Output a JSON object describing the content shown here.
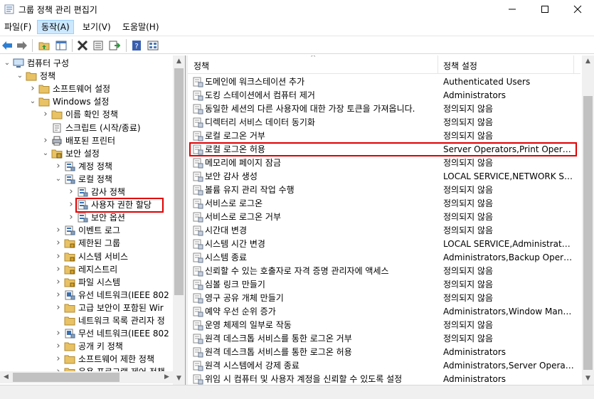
{
  "window": {
    "title": "그룹 정책 관리 편집기"
  },
  "menu": [
    {
      "label": "파일(F)"
    },
    {
      "label": "동작(A)",
      "active": true
    },
    {
      "label": "보기(V)"
    },
    {
      "label": "도움말(H)"
    }
  ],
  "toolbar": {
    "buttons": [
      "back-icon",
      "forward-icon",
      "up-folder-icon",
      "show-hide-tree-icon",
      "delete-icon",
      "properties-icon",
      "export-list-icon",
      "help-icon",
      "view-icon"
    ]
  },
  "tree": {
    "items": [
      {
        "label": "컴퓨터 구성",
        "level": 0,
        "expanded": true,
        "icon": "computer-icon"
      },
      {
        "label": "정책",
        "level": 1,
        "expanded": true,
        "icon": "folder-icon"
      },
      {
        "label": "소프트웨어 설정",
        "level": 2,
        "expanded": false,
        "icon": "folder-icon"
      },
      {
        "label": "Windows 설정",
        "level": 2,
        "expanded": true,
        "icon": "folder-icon"
      },
      {
        "label": "이름 확인 정책",
        "level": 3,
        "expanded": false,
        "icon": "folder-icon"
      },
      {
        "label": "스크립트 (시작/종료)",
        "level": 3,
        "leaf": true,
        "icon": "script-icon"
      },
      {
        "label": "배포된 프린터",
        "level": 3,
        "expanded": false,
        "icon": "printer-icon"
      },
      {
        "label": "보안 설정",
        "level": 3,
        "expanded": true,
        "icon": "security-icon"
      },
      {
        "label": "계정 정책",
        "level": 4,
        "expanded": false,
        "icon": "policy-icon"
      },
      {
        "label": "로컬 정책",
        "level": 4,
        "expanded": true,
        "icon": "policy-icon"
      },
      {
        "label": "감사 정책",
        "level": 5,
        "expanded": false,
        "icon": "policy-icon"
      },
      {
        "label": "사용자 권한 할당",
        "level": 5,
        "expanded": false,
        "icon": "policy-icon",
        "selected": true
      },
      {
        "label": "보안 옵션",
        "level": 5,
        "expanded": false,
        "icon": "policy-icon"
      },
      {
        "label": "이벤트 로그",
        "level": 4,
        "expanded": false,
        "icon": "policy-icon"
      },
      {
        "label": "제한된 그룹",
        "level": 4,
        "expanded": false,
        "icon": "lock-folder-icon"
      },
      {
        "label": "시스템 서비스",
        "level": 4,
        "expanded": false,
        "icon": "lock-folder-icon"
      },
      {
        "label": "레지스트리",
        "level": 4,
        "expanded": false,
        "icon": "lock-folder-icon"
      },
      {
        "label": "파일 시스템",
        "level": 4,
        "expanded": false,
        "icon": "lock-folder-icon"
      },
      {
        "label": "유선 네트워크(IEEE 802",
        "level": 4,
        "expanded": false,
        "icon": "network-icon"
      },
      {
        "label": "고급 보안이 포함된 Wir",
        "level": 4,
        "expanded": false,
        "icon": "folder-icon"
      },
      {
        "label": "네트워크 목록 관리자 정",
        "level": 4,
        "leaf": true,
        "icon": "folder-icon"
      },
      {
        "label": "무선 네트워크(IEEE 802",
        "level": 4,
        "expanded": false,
        "icon": "network-icon"
      },
      {
        "label": "공개 키 정책",
        "level": 4,
        "expanded": false,
        "icon": "folder-icon"
      },
      {
        "label": "소프트웨어 제한 정책",
        "level": 4,
        "expanded": false,
        "icon": "folder-icon"
      },
      {
        "label": "응용 프로그램 제어 정책",
        "level": 4,
        "expanded": false,
        "icon": "folder-icon"
      }
    ]
  },
  "list": {
    "columns": [
      "정책",
      "정책 설정"
    ],
    "rows": [
      {
        "name": "도메인에 워크스테이션 추가",
        "value": "Authenticated Users"
      },
      {
        "name": "도킹 스테이션에서 컴퓨터 제거",
        "value": "Administrators"
      },
      {
        "name": "동일한 세션의 다른 사용자에 대한 가장 토큰을 가져옵니다.",
        "value": "정의되지 않음"
      },
      {
        "name": "디렉터리 서비스 데이터 동기화",
        "value": "정의되지 않음"
      },
      {
        "name": "로컬 로그온 거부",
        "value": "정의되지 않음"
      },
      {
        "name": "로컬 로그온 허용",
        "value": "Server Operators,Print Operator...",
        "highlight": true
      },
      {
        "name": "메모리에 페이지 잠금",
        "value": "정의되지 않음"
      },
      {
        "name": "보안 감사 생성",
        "value": "LOCAL SERVICE,NETWORK SER..."
      },
      {
        "name": "볼륨 유지 관리 작업 수행",
        "value": "정의되지 않음"
      },
      {
        "name": "서비스로 로그온",
        "value": "정의되지 않음"
      },
      {
        "name": "서비스로 로그온 거부",
        "value": "정의되지 않음"
      },
      {
        "name": "시간대 변경",
        "value": "정의되지 않음"
      },
      {
        "name": "시스템 시간 변경",
        "value": "LOCAL SERVICE,Administrators..."
      },
      {
        "name": "시스템 종료",
        "value": "Administrators,Backup Operato..."
      },
      {
        "name": "신뢰할 수 있는 호출자로 자격 증명 관리자에 액세스",
        "value": "정의되지 않음"
      },
      {
        "name": "심볼 링크 만들기",
        "value": "정의되지 않음"
      },
      {
        "name": "영구 공유 개체 만들기",
        "value": "정의되지 않음"
      },
      {
        "name": "예약 우선 순위 증가",
        "value": "Administrators,Window Manag..."
      },
      {
        "name": "운영 체제의 일부로 작동",
        "value": "정의되지 않음"
      },
      {
        "name": "원격 데스크톱 서비스를 통한 로그온 거부",
        "value": "정의되지 않음"
      },
      {
        "name": "원격 데스크톱 서비스를 통한 로그온 허용",
        "value": "Administrators"
      },
      {
        "name": "원격 시스템에서 강제 종료",
        "value": "Administrators,Server Operators"
      },
      {
        "name": "위임 시 컴퓨터 및 사용자 계정을 신뢰할 수 있도록 설정",
        "value": "Administrators"
      }
    ]
  },
  "colors": {
    "highlight": "#e00000",
    "menu_active": "#cce8ff",
    "folder": "#e8c264"
  }
}
